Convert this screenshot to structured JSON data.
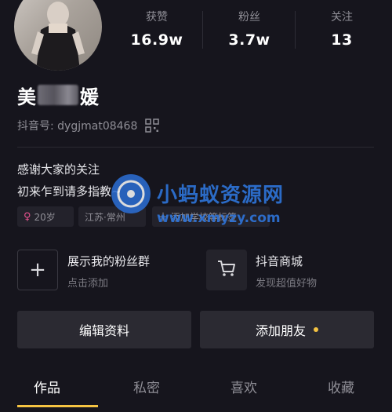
{
  "stats": [
    {
      "label": "获赞",
      "value": "16.9w"
    },
    {
      "label": "粉丝",
      "value": "3.7w"
    },
    {
      "label": "关注",
      "value": "13"
    }
  ],
  "profile": {
    "name_start": "美",
    "name_end": "媛",
    "douyin_id": "抖音号: dygjmat08468"
  },
  "bio": {
    "line1": "感谢大家的关注",
    "line2": "初来乍到请多指教~"
  },
  "tags": {
    "age": "20岁",
    "location": "江苏·常州",
    "school": "十 添加学校等标签"
  },
  "watermark": {
    "title": "小蚂蚁资源网",
    "url": "www.xmyzy.com"
  },
  "features": {
    "fan_group": {
      "title": "展示我的粉丝群",
      "subtitle": "点击添加"
    },
    "shop": {
      "title": "抖音商城",
      "subtitle": "发现超值好物"
    }
  },
  "buttons": {
    "edit": "编辑资料",
    "add_friend": "添加朋友"
  },
  "tabs": [
    "作品",
    "私密",
    "喜欢",
    "收藏"
  ],
  "colors": {
    "background": "#16151d",
    "accent": "#f5c342",
    "female": "#e8528f",
    "watermark": "#2f7ae5"
  }
}
